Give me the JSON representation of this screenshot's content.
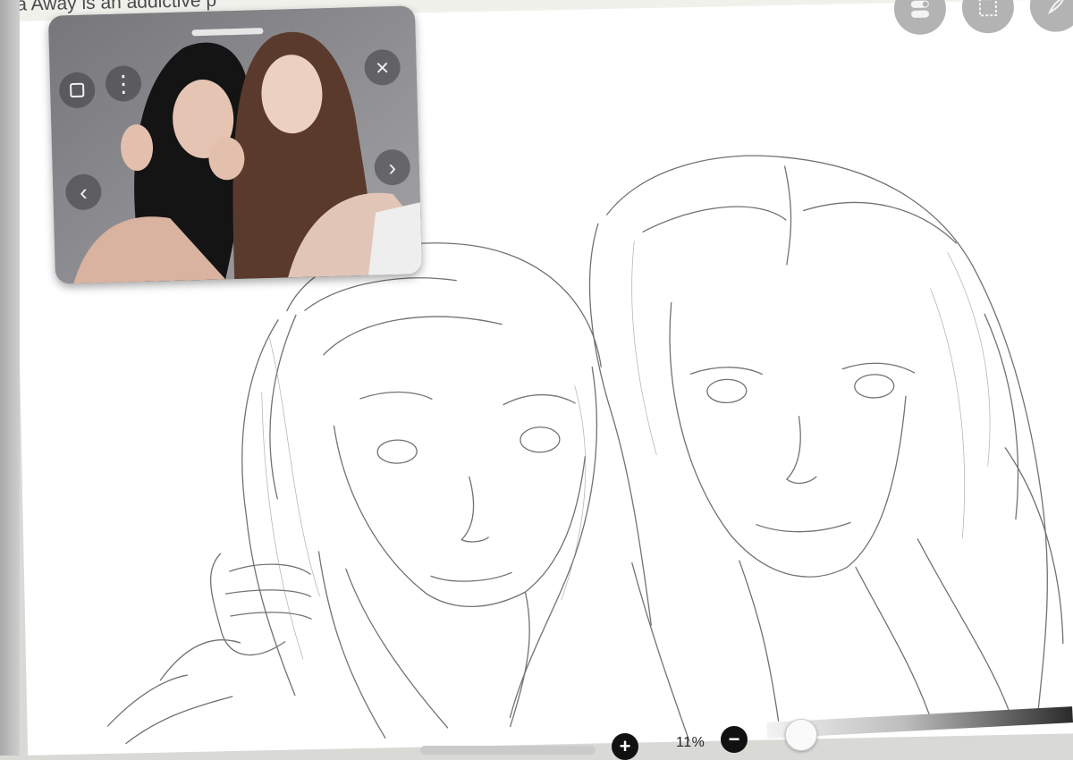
{
  "banner": {
    "text": "exa Away is an addictive p"
  },
  "tools": [
    {
      "name": "layers-toggle-icon"
    },
    {
      "name": "selection-icon"
    },
    {
      "name": "brush-icon"
    }
  ],
  "reference_window": {
    "buttons": {
      "crop": "crop-icon",
      "more": "⋮",
      "close": "×",
      "prev": "‹",
      "next": "›"
    }
  },
  "zoom": {
    "value": "11%",
    "plus": "+",
    "minus": "−"
  },
  "colors": {
    "canvas": "#ffffff",
    "sketch_stroke": "#555555",
    "button_bg": "#b3b3b3"
  }
}
